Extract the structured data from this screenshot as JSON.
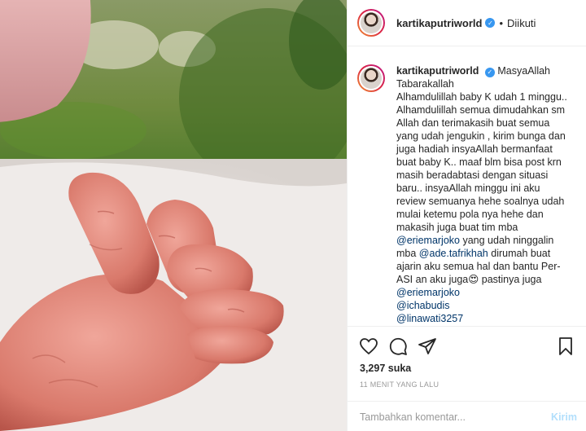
{
  "post": {
    "username": "kartikaputriworld",
    "follow_state": "Diikuti",
    "separator": "•",
    "verified_icon": "check-icon"
  },
  "caption": {
    "username": "kartikaputriworld",
    "text": "MasyaAllah Tabarakallah\nAlhamdulillah baby K udah 1 minggu..\nAlhamdulillah semua dimudahkan sm Allah dan terimakasih buat semua yang udah jengukin , kirim bunga dan juga hadiah insyaAllah bermanfaat buat baby K.. maaf blm bisa post krn masih beradabtasi dengan situasi baru.. insyaAllah minggu ini aku review semuanya hehe soalnya udah mulai ketemu pola nya hehe dan makasih juga buat tim mba",
    "mention_1": "@eriemarjoko",
    "text_2": " yang udah ninggalin mba ",
    "mention_2": "@ade.tafrikhah",
    "text_3": " dirumah buat ajarin aku semua hal dan bantu Per-ASI an aku juga😍 pastinya juga",
    "mention_3": "@eriemarjoko",
    "mention_4": "@ichabudis",
    "mention_5": "@linawati3257"
  },
  "actions": {
    "like_icon": "heart-icon",
    "comment_icon": "comment-icon",
    "share_icon": "share-icon",
    "save_icon": "bookmark-icon",
    "likes": "3,297 suka",
    "time": "11 MENIT YANG LALU"
  },
  "comment_box": {
    "placeholder": "Tambahkan komentar...",
    "post_label": "Kirim"
  },
  "colors": {
    "accent": "#3897f0",
    "link": "#003569",
    "disabled_post": "#b2dffc"
  }
}
